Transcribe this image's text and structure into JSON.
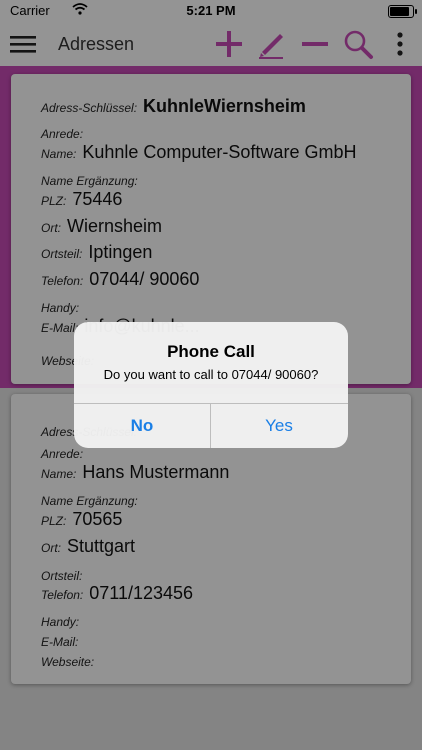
{
  "status": {
    "carrier": "Carrier",
    "time": "5:21 PM",
    "battery_level": 0.95
  },
  "nav": {
    "title": "Adressen",
    "icons": [
      "menu-icon",
      "add-icon",
      "edit-icon",
      "remove-icon",
      "search-icon",
      "more-icon"
    ],
    "accent": "#c048b0"
  },
  "cards": [
    {
      "schluessel_label": "Adress-Schlüssel:",
      "schluessel": "KuhnleWiernsheim",
      "anrede_label": "Anrede:",
      "anrede": "",
      "name_label": "Name:",
      "name": "Kuhnle Computer-Software GmbH",
      "name2_label": "Name Ergänzung:",
      "name2": "",
      "plz_label": "PLZ:",
      "plz": "75446",
      "ort_label": "Ort:",
      "ort": "Wiernsheim",
      "ortsteil_label": "Ortsteil:",
      "ortsteil": "Iptingen",
      "telefon_label": "Telefon:",
      "telefon": "07044/ 90060",
      "handy_label": "Handy:",
      "handy": "",
      "email_label": "E-Mail:",
      "email": "info@kuhnle...",
      "web_label": "Webseite:",
      "web": ""
    },
    {
      "schluessel_label": "Adress-Schlüssel:",
      "schluessel": "",
      "anrede_label": "Anrede:",
      "anrede": "",
      "name_label": "Name:",
      "name": "Hans Mustermann",
      "name2_label": "Name Ergänzung:",
      "name2": "",
      "plz_label": "PLZ:",
      "plz": "70565",
      "ort_label": "Ort:",
      "ort": "Stuttgart",
      "ortsteil_label": "Ortsteil:",
      "ortsteil": "",
      "telefon_label": "Telefon:",
      "telefon": "0711/123456",
      "handy_label": "Handy:",
      "handy": "",
      "email_label": "E-Mail:",
      "email": "",
      "web_label": "Webseite:",
      "web": ""
    }
  ],
  "alert": {
    "title": "Phone Call",
    "message": "Do you want to call to 07044/ 90060?",
    "no_label": "No",
    "yes_label": "Yes",
    "button_color": "#1a7fe6"
  }
}
